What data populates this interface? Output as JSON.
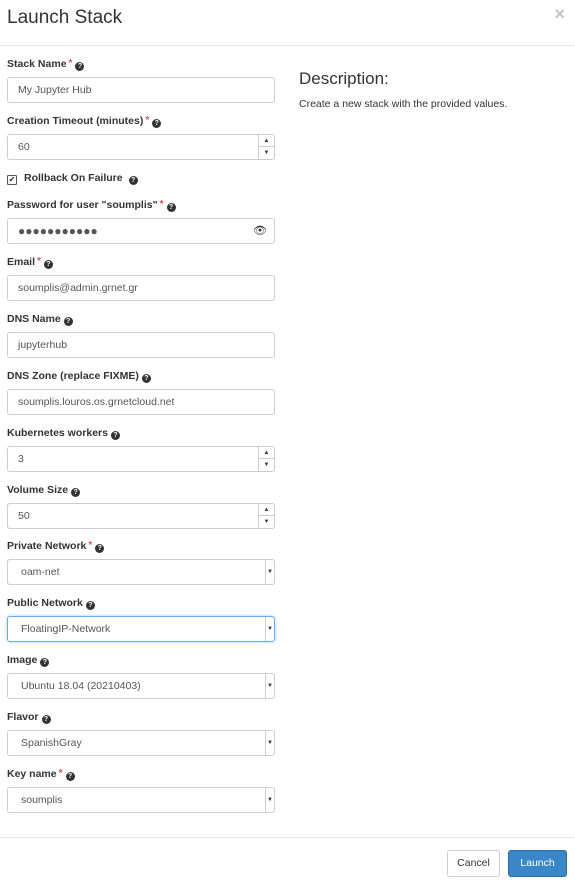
{
  "modal": {
    "title": "Launch Stack",
    "close_glyph": "×"
  },
  "fields": {
    "stack_name": {
      "label": "Stack Name",
      "value": "My Jupyter Hub",
      "required": true
    },
    "creation_timeout": {
      "label": "Creation Timeout (minutes)",
      "value": "60",
      "required": true
    },
    "rollback": {
      "label": "Rollback On Failure",
      "checked": true
    },
    "password": {
      "label": "Password for user \"soumplis\"",
      "value": "●●●●●●●●●●●",
      "required": true
    },
    "email": {
      "label": "Email",
      "value": "soumplis@admin.grnet.gr",
      "required": true
    },
    "dns_name": {
      "label": "DNS Name",
      "value": "jupyterhub"
    },
    "dns_zone": {
      "label": "DNS Zone (replace FIXME)",
      "value": "soumplis.louros.os.grnetcloud.net"
    },
    "k8s_workers": {
      "label": "Kubernetes workers",
      "value": "3"
    },
    "volume_size": {
      "label": "Volume Size",
      "value": "50"
    },
    "private_network": {
      "label": "Private Network",
      "value": "oam-net",
      "required": true
    },
    "public_network": {
      "label": "Public Network",
      "value": "FloatingIP-Network"
    },
    "image": {
      "label": "Image",
      "value": "Ubuntu 18.04 (20210403)"
    },
    "flavor": {
      "label": "Flavor",
      "value": "SpanishGray"
    },
    "key_name": {
      "label": "Key name",
      "value": "soumplis",
      "required": true
    }
  },
  "glyphs": {
    "required": "*",
    "help": "?",
    "check": "✔",
    "up": "▲",
    "down": "▼",
    "eye": "👁"
  },
  "icons": [
    "close-icon",
    "help-icon",
    "checkbox-icon",
    "eye-icon",
    "spinner-up-icon",
    "spinner-down-icon",
    "dropdown-arrow-icon"
  ],
  "description": {
    "title": "Description:",
    "text": "Create a new stack with the provided values."
  },
  "footer": {
    "cancel_label": "Cancel",
    "launch_label": "Launch"
  },
  "colors": {
    "required": "#d9534f",
    "primary": "#3a87c8",
    "focus_border": "#66afe9"
  }
}
